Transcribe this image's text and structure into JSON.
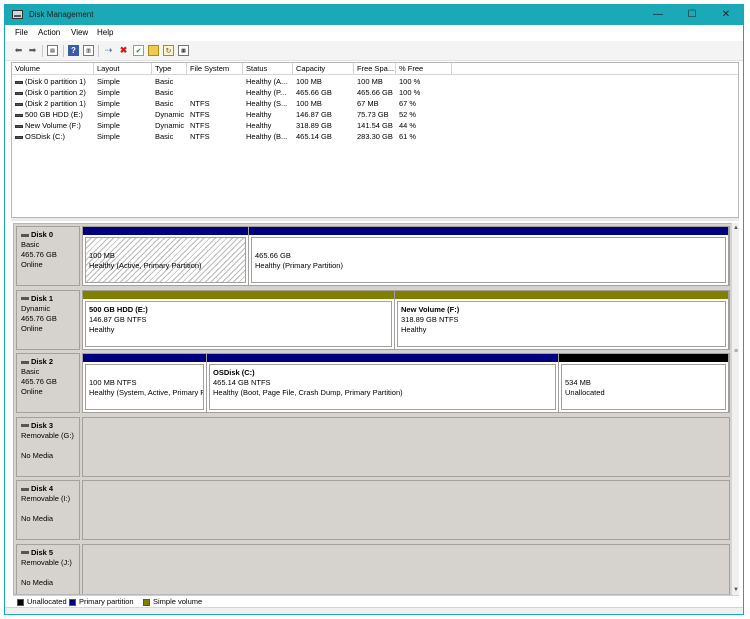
{
  "window": {
    "title": "Disk Management",
    "minimize": "—",
    "maximize": "☐",
    "close": "✕",
    "accent": "#1ba9b8"
  },
  "menu": [
    "File",
    "Action",
    "View",
    "Help"
  ],
  "toolbar": {
    "icons": [
      "back-icon",
      "forward-icon",
      "show-hide-console-tree-icon",
      "help-icon",
      "properties-icon",
      "connect-virtual-disk-icon",
      "delete-icon",
      "checklist-icon",
      "new-folder-icon",
      "rescan-icon",
      "properties-pane-icon"
    ]
  },
  "volume_list": {
    "columns": [
      "Volume",
      "Layout",
      "Type",
      "File System",
      "Status",
      "Capacity",
      "Free Spa...",
      "% Free"
    ],
    "rows": [
      [
        "(Disk 0 partition 1)",
        "Simple",
        "Basic",
        "",
        "Healthy (A...",
        "100 MB",
        "100 MB",
        "100 %"
      ],
      [
        "(Disk 0 partition 2)",
        "Simple",
        "Basic",
        "",
        "Healthy (P...",
        "465.66 GB",
        "465.66 GB",
        "100 %"
      ],
      [
        "(Disk 2 partition 1)",
        "Simple",
        "Basic",
        "NTFS",
        "Healthy (S...",
        "100 MB",
        "67 MB",
        "67 %"
      ],
      [
        "500 GB HDD (E:)",
        "Simple",
        "Dynamic",
        "NTFS",
        "Healthy",
        "146.87 GB",
        "75.73 GB",
        "52 %"
      ],
      [
        "New Volume (F:)",
        "Simple",
        "Dynamic",
        "NTFS",
        "Healthy",
        "318.89 GB",
        "141.54 GB",
        "44 %"
      ],
      [
        "OSDisk (C:)",
        "Simple",
        "Basic",
        "NTFS",
        "Healthy (B...",
        "465.14 GB",
        "283.30 GB",
        "61 %"
      ]
    ]
  },
  "disks": [
    {
      "name": "Disk 0",
      "kind": "Basic",
      "size": "465.76 GB",
      "state": "Online",
      "partitions": [
        {
          "label": "",
          "size": "100 MB",
          "status": "Healthy (Active, Primary Partition)",
          "bar": "primary",
          "hatched": true
        },
        {
          "label": "",
          "size": "465.66 GB",
          "status": "Healthy (Primary Partition)",
          "bar": "primary",
          "hatched": false
        }
      ]
    },
    {
      "name": "Disk 1",
      "kind": "Dynamic",
      "size": "465.76 GB",
      "state": "Online",
      "partitions": [
        {
          "label": "500 GB HDD  (E:)",
          "size": "146.87 GB NTFS",
          "status": "Healthy",
          "bar": "simple",
          "hatched": false
        },
        {
          "label": "New Volume  (F:)",
          "size": "318.89 GB NTFS",
          "status": "Healthy",
          "bar": "simple",
          "hatched": false
        }
      ]
    },
    {
      "name": "Disk 2",
      "kind": "Basic",
      "size": "465.76 GB",
      "state": "Online",
      "partitions": [
        {
          "label": "",
          "size": "100 MB NTFS",
          "status": "Healthy (System, Active, Primary P",
          "bar": "primary",
          "hatched": false
        },
        {
          "label": "OSDisk  (C:)",
          "size": "465.14 GB NTFS",
          "status": "Healthy (Boot, Page File, Crash Dump, Primary Partition)",
          "bar": "primary",
          "hatched": false
        },
        {
          "label": "",
          "size": "534 MB",
          "status": "Unallocated",
          "bar": "unallocated",
          "hatched": false
        }
      ]
    },
    {
      "name": "Disk 3",
      "kind": "Removable (G:)",
      "size": "",
      "state": "No Media",
      "partitions": []
    },
    {
      "name": "Disk 4",
      "kind": "Removable (I:)",
      "size": "",
      "state": "No Media",
      "partitions": []
    },
    {
      "name": "Disk 5",
      "kind": "Removable (J:)",
      "size": "",
      "state": "No Media",
      "partitions": []
    }
  ],
  "legend": [
    {
      "label": "Unallocated",
      "color": "#000000"
    },
    {
      "label": "Primary partition",
      "color": "#00007f"
    },
    {
      "label": "Simple volume",
      "color": "#808000"
    }
  ],
  "colors": {
    "primary": "#00007f",
    "simple": "#808000",
    "unallocated": "#000000"
  }
}
